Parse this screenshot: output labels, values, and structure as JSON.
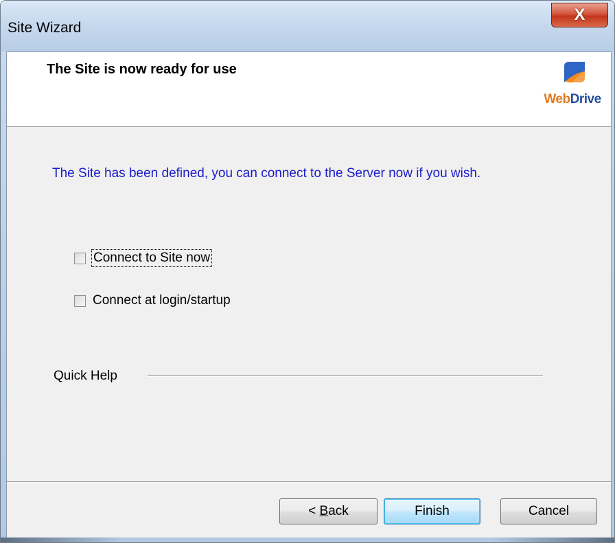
{
  "window": {
    "title": "Site Wizard",
    "close_glyph": "X"
  },
  "header": {
    "title": "The Site is now ready for use",
    "logo": {
      "web": "Web",
      "drive": "Drive",
      "icon": "webdrive-logo-icon"
    }
  },
  "main": {
    "info_text": "The Site has been defined, you can connect to the Server now if you wish.",
    "checkboxes": [
      {
        "label": "Connect to Site now",
        "checked": false,
        "focused": true
      },
      {
        "label": "Connect at login/startup",
        "checked": false,
        "focused": false
      }
    ],
    "quick_help_label": "Quick Help"
  },
  "buttons": {
    "back_prefix": "< ",
    "back_mnemonic": "B",
    "back_rest": "ack",
    "finish": "Finish",
    "cancel": "Cancel"
  },
  "colors": {
    "info_text": "#1a1acc",
    "logo_web": "#e07a1f",
    "logo_drive": "#1f4e9c",
    "close_button": "#c3351c"
  }
}
